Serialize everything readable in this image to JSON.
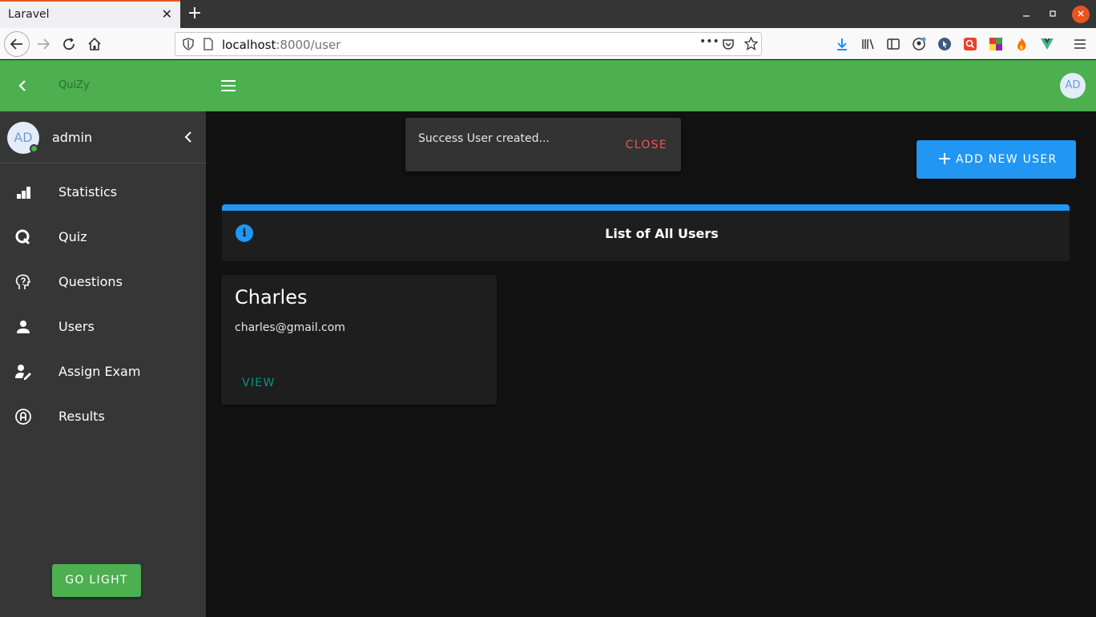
{
  "browser": {
    "tab_title": "Laravel",
    "tab_close": "✕",
    "new_tab": "+",
    "url_host": "localhost",
    "url_path": ":8000/user",
    "page_actions": "•••"
  },
  "header": {
    "brand": "QuiZy",
    "avatar_initials": "AD",
    "color": "#4caf50"
  },
  "sidebar": {
    "profile": {
      "initials": "AD",
      "name": "admin"
    },
    "items": [
      {
        "label": "Statistics",
        "icon": "bar-chart-icon"
      },
      {
        "label": "Quiz",
        "icon": "quiz-q-icon"
      },
      {
        "label": "Questions",
        "icon": "head-question-icon"
      },
      {
        "label": "Users",
        "icon": "person-icon"
      },
      {
        "label": "Assign Exam",
        "icon": "person-edit-icon"
      },
      {
        "label": "Results",
        "icon": "alpha-a-circle-icon"
      }
    ],
    "theme_button": "GO LIGHT"
  },
  "snackbar": {
    "message": "Success User created...",
    "close_label": "CLOSE"
  },
  "main": {
    "add_button": "ADD NEW USER",
    "alert_title": "List of All Users",
    "users": [
      {
        "name": "Charles",
        "email": "charles@gmail.com",
        "action": "VIEW"
      }
    ]
  }
}
